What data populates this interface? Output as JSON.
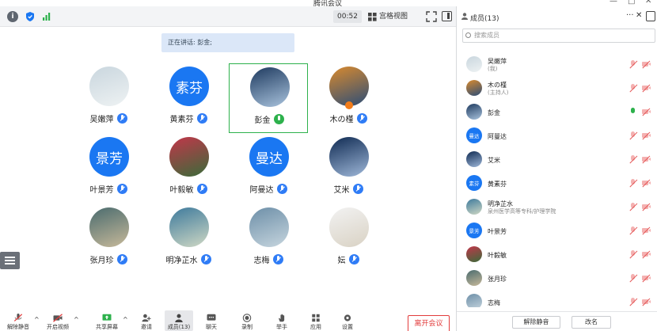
{
  "window": {
    "title": "腾讯会议",
    "minimize": "—",
    "maximize": "□",
    "close": "✕"
  },
  "toolbar": {
    "timer": "00:52",
    "view_label": "宫格视图"
  },
  "banner": {
    "speaking": "正在讲话: 彭金;"
  },
  "participants": [
    {
      "name": "吴嫩萍",
      "avatar_text": "",
      "avatar_colors": [
        "#c9d6de",
        "#eef2f3"
      ],
      "mic_on": false,
      "active": false,
      "host": false
    },
    {
      "name": "黄素芬",
      "avatar_text": "素芬",
      "mic_on": false,
      "active": false,
      "host": false
    },
    {
      "name": "彭金",
      "avatar_text": "",
      "avatar_colors": [
        "#1e3a5f",
        "#a9c3dd"
      ],
      "mic_on": true,
      "active": true,
      "host": false
    },
    {
      "name": "木の槿",
      "avatar_text": "",
      "avatar_colors": [
        "#d98a2e",
        "#2c4d77"
      ],
      "mic_on": false,
      "active": false,
      "host": true
    },
    {
      "name": "叶景芳",
      "avatar_text": "景芳",
      "mic_on": false,
      "active": false,
      "host": false
    },
    {
      "name": "叶毅敏",
      "avatar_text": "",
      "avatar_colors": [
        "#c2364a",
        "#3a6b3a"
      ],
      "mic_on": false,
      "active": false,
      "host": false
    },
    {
      "name": "阿曼达",
      "avatar_text": "曼达",
      "mic_on": false,
      "active": false,
      "host": false
    },
    {
      "name": "艾米",
      "avatar_text": "",
      "avatar_colors": [
        "#0f2a52",
        "#9fb8d9"
      ],
      "mic_on": false,
      "active": false,
      "host": false
    },
    {
      "name": "张月珍",
      "avatar_text": "",
      "avatar_colors": [
        "#4a6b6e",
        "#c7b99a"
      ],
      "mic_on": false,
      "active": false,
      "host": false
    },
    {
      "name": "明净芷水",
      "avatar_text": "",
      "avatar_colors": [
        "#3e7a9c",
        "#cfd8c4"
      ],
      "mic_on": false,
      "active": false,
      "host": false
    },
    {
      "name": "志梅",
      "avatar_text": "",
      "avatar_colors": [
        "#6d8fa8",
        "#c6d5de"
      ],
      "mic_on": false,
      "active": false,
      "host": false
    },
    {
      "name": "妘",
      "avatar_text": "",
      "avatar_colors": [
        "#f2f2f2",
        "#d9d2c4"
      ],
      "mic_on": false,
      "active": false,
      "host": false
    }
  ],
  "bottom": {
    "buttons": [
      "解除静音",
      "开启视频",
      "共享屏幕",
      "邀请",
      "成员(13)",
      "聊天",
      "录制",
      "举手",
      "应用",
      "设置"
    ],
    "leave": "离开会议"
  },
  "panel": {
    "title": "成员(13)",
    "more": "···",
    "close": "✕",
    "search_placeholder": "搜索成员",
    "members": [
      {
        "name": "吴嫩萍",
        "sub": "(我)",
        "avatar_text": "",
        "avatar_colors": [
          "#c9d6de",
          "#eef2f3"
        ],
        "mic_on": false
      },
      {
        "name": "木の槿",
        "sub": "(主持人)",
        "avatar_text": "",
        "avatar_colors": [
          "#d98a2e",
          "#2c4d77"
        ],
        "mic_on": false
      },
      {
        "name": "彭金",
        "sub": "",
        "avatar_text": "",
        "avatar_colors": [
          "#1e3a5f",
          "#a9c3dd"
        ],
        "mic_on": true
      },
      {
        "name": "阿曼达",
        "sub": "",
        "avatar_text": "曼达",
        "mic_on": false
      },
      {
        "name": "艾米",
        "sub": "",
        "avatar_text": "",
        "avatar_colors": [
          "#0f2a52",
          "#9fb8d9"
        ],
        "mic_on": false
      },
      {
        "name": "黄素芬",
        "sub": "",
        "avatar_text": "素芬",
        "mic_on": false
      },
      {
        "name": "明净芷水",
        "sub": "泉州医学高等专科/护理学院",
        "avatar_text": "",
        "avatar_colors": [
          "#3e7a9c",
          "#cfd8c4"
        ],
        "mic_on": false
      },
      {
        "name": "叶景芳",
        "sub": "",
        "avatar_text": "景芳",
        "mic_on": false
      },
      {
        "name": "叶毅敏",
        "sub": "",
        "avatar_text": "",
        "avatar_colors": [
          "#c2364a",
          "#3a6b3a"
        ],
        "mic_on": false
      },
      {
        "name": "张月珍",
        "sub": "",
        "avatar_text": "",
        "avatar_colors": [
          "#4a6b6e",
          "#c7b99a"
        ],
        "mic_on": false
      },
      {
        "name": "志梅",
        "sub": "",
        "avatar_text": "",
        "avatar_colors": [
          "#6d8fa8",
          "#c6d5de"
        ],
        "mic_on": false
      }
    ],
    "unmute_all": "解除静音",
    "rename": "改名"
  }
}
